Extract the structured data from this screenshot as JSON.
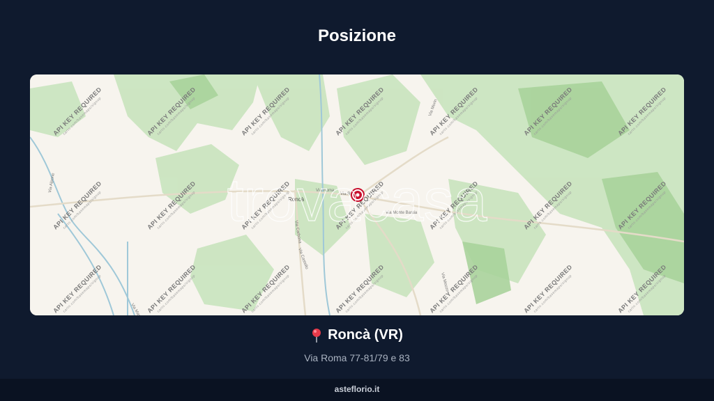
{
  "page": {
    "title": "Posizione"
  },
  "map": {
    "watermark_tile": "API KEY REQUIRED",
    "watermark_tile_sub": "carto.com/basemaps/signup",
    "brand_watermark": "trovacasa",
    "town_label": "Roncà",
    "road_labels": [
      "Via Roma",
      "Via Roma",
      "Via Monte Bastia",
      "Via Alpone",
      "Via Mascherpa",
      "Via Carbona",
      "Via Castello",
      "Via Mezzo",
      "Via Morin"
    ],
    "marker": "marker-icon",
    "colors": {
      "land": "#f7f4ee",
      "forest": "#bfe0b4",
      "river": "#9fc8d8",
      "marker": "#c8102e"
    }
  },
  "location": {
    "icon": "pin-icon",
    "name": "Roncà (VR)",
    "address": "Via Roma 77-81/79 e 83"
  },
  "footer": {
    "text": "asteflorio.it"
  }
}
